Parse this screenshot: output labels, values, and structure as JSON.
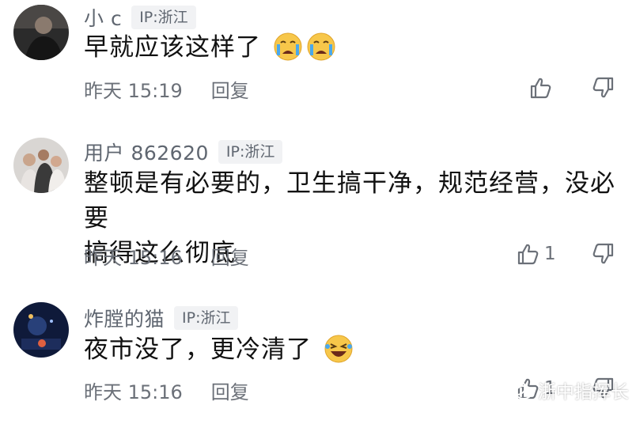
{
  "comments": [
    {
      "username": "小 c",
      "ip": "IP:浙江",
      "text": "早就应该这样了",
      "time": "昨天 15:19",
      "reply_label": "回复",
      "like_count": "",
      "emojis": [
        "crying-face",
        "crying-face"
      ]
    },
    {
      "username": "用户 862620",
      "ip": "IP:浙江",
      "text_line1": "整顿是有必要的，卫生搞干净，规范经营，没必要",
      "text_line2": "搞得这么彻底",
      "time": "昨天 15:16",
      "reply_label": "回复",
      "like_count": "1"
    },
    {
      "username": "炸膛的猫",
      "ip": "IP:浙江",
      "text": "夜市没了，更冷清了",
      "time": "昨天 15:16",
      "reply_label": "回复",
      "like_count": "1",
      "emojis": [
        "laughing-crying-face"
      ]
    }
  ],
  "watermark": "浙中指挥长",
  "colors": {
    "meta": "#6b7078",
    "badge_bg": "#f1f2f4",
    "emoji": "#f7c74a"
  }
}
